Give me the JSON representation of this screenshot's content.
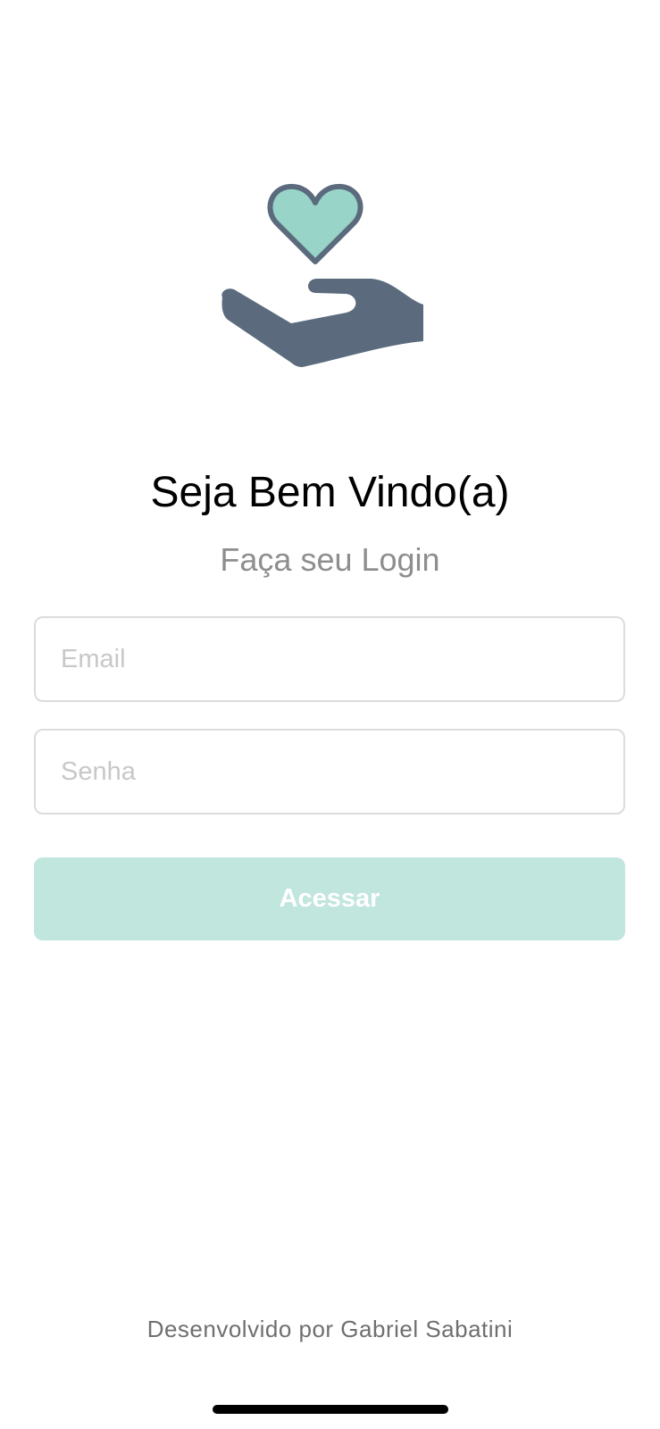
{
  "logo": {
    "icon": "hand-holding-heart-icon",
    "colors": {
      "heart_fill": "#98d4c8",
      "outline": "#5b6b7d",
      "hand": "#5b6b7d"
    }
  },
  "header": {
    "title": "Seja Bem Vindo(a)",
    "subtitle": "Faça seu Login"
  },
  "form": {
    "email_placeholder": "Email",
    "email_value": "",
    "password_placeholder": "Senha",
    "password_value": "",
    "submit_label": "Acessar"
  },
  "theme": {
    "accent": "#c0e6de",
    "field_border": "#dcdcdc",
    "placeholder_color": "#c8c8c8"
  },
  "footer": {
    "credit": "Desenvolvido por Gabriel Sabatini"
  }
}
